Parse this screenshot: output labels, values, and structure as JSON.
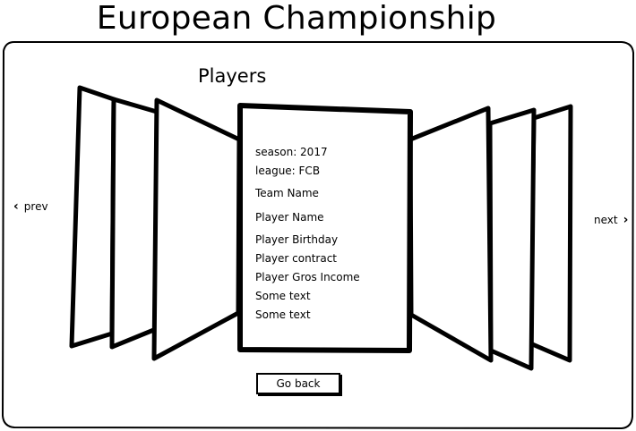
{
  "header": {
    "title": "European Championship"
  },
  "main": {
    "section_title": "Players",
    "prev_label": "prev",
    "next_label": "next",
    "card": {
      "fields": [
        "season: 2017",
        "league: FCB",
        "Team Name",
        "Player Name",
        "Player Birthday",
        "Player contract",
        "Player Gros Income",
        "Some text",
        "Some text"
      ]
    },
    "go_back_label": "Go back"
  },
  "icons": {
    "prev": "chevron-left-icon",
    "next": "chevron-right-icon"
  }
}
